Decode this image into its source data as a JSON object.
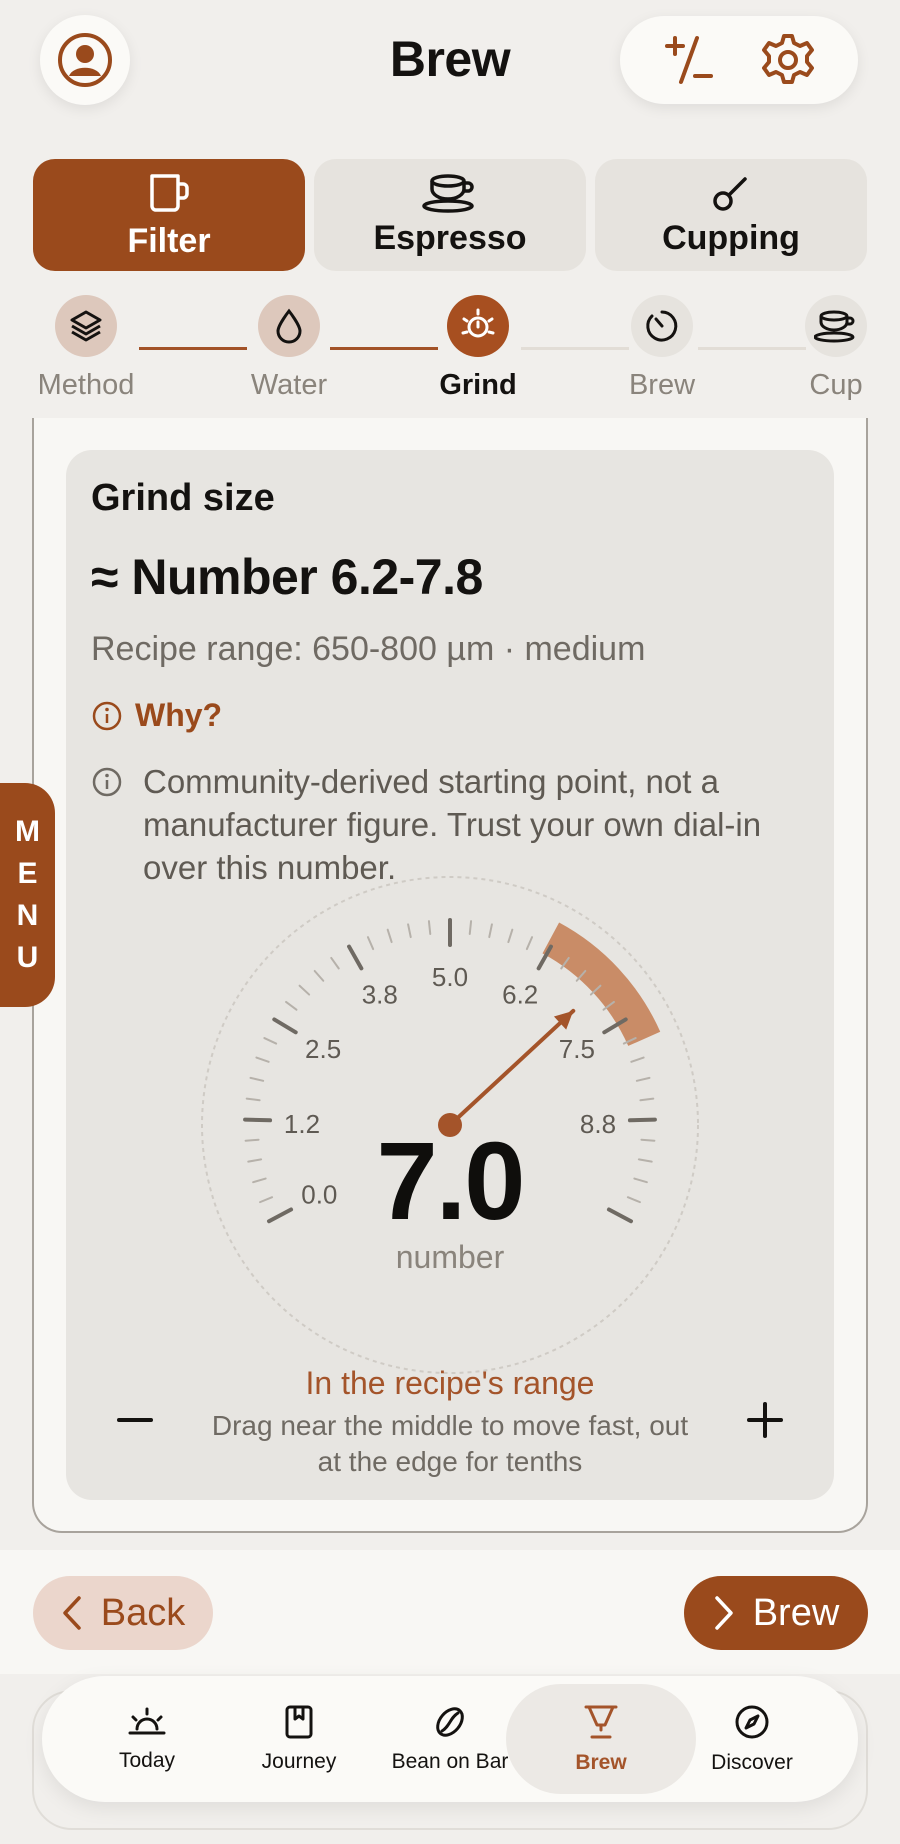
{
  "header": {
    "title": "Brew"
  },
  "mode_tabs": [
    {
      "label": "Filter",
      "active": true
    },
    {
      "label": "Espresso",
      "active": false
    },
    {
      "label": "Cupping",
      "active": false
    }
  ],
  "steps": [
    {
      "label": "Method",
      "state": "done"
    },
    {
      "label": "Water",
      "state": "done"
    },
    {
      "label": "Grind",
      "state": "current"
    },
    {
      "label": "Brew",
      "state": "upcoming"
    },
    {
      "label": "Cup",
      "state": "upcoming"
    }
  ],
  "grind": {
    "label": "Grind size",
    "value": "≈ Number 6.2-7.8",
    "recipe_range": "Recipe range: 650-800 µm · medium",
    "why": "Why?",
    "note": "Community-derived starting point, not a manufacturer figure. Trust your own dial-in over this number."
  },
  "dial": {
    "current": "7.0",
    "current_value": 7.0,
    "unit": "number",
    "scale_min": 0.0,
    "scale_max": 10.0,
    "range_min": 6.2,
    "range_max": 7.8,
    "tick_labels": [
      "0.0",
      "1.2",
      "2.5",
      "3.8",
      "5.0",
      "6.2",
      "7.5",
      "8.8"
    ],
    "status": "In the recipe's range",
    "hint": "Drag near the middle to move fast, out at the edge for tenths"
  },
  "actions": {
    "back": "Back",
    "next": "Brew"
  },
  "tabbar": [
    {
      "label": "Today",
      "icon": "sunrise-icon",
      "active": false
    },
    {
      "label": "Journey",
      "icon": "journal-icon",
      "active": false
    },
    {
      "label": "Bean on Bar",
      "icon": "bean-icon",
      "active": false
    },
    {
      "label": "Brew",
      "icon": "dripper-icon",
      "active": true
    },
    {
      "label": "Discover",
      "icon": "compass-icon",
      "active": false
    }
  ],
  "side_menu": {
    "label": "MENU"
  },
  "colors": {
    "accent": "#9a4a1c",
    "accent_soft": "#ebd6cc",
    "background": "#f1efec",
    "card": "#e7e5e1"
  }
}
